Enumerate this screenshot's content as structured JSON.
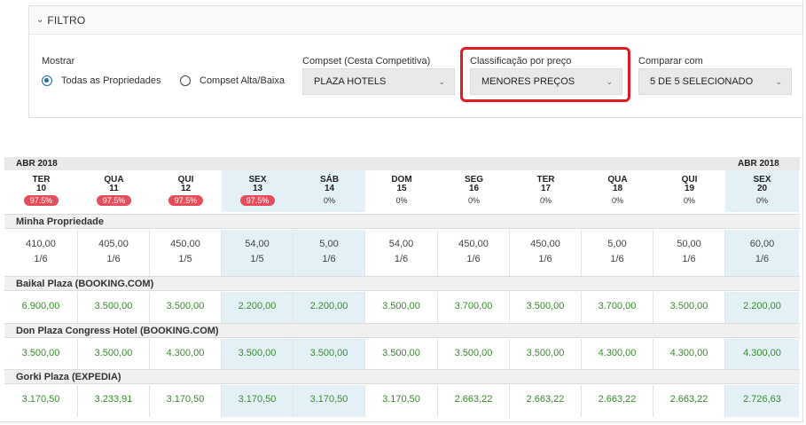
{
  "filter": {
    "title": "FILTRO",
    "show_label": "Mostrar",
    "radio_all": "Todas as Propriedades",
    "radio_compset": "Compset Alta/Baixa",
    "compset_label": "Compset (Cesta Competitiva)",
    "compset_value": "PLAZA HOTELS",
    "sort_label": "Classificação por preço",
    "sort_value": "MENORES PREÇOS",
    "compare_label": "Comparar com",
    "compare_value": "5 DE 5 SELECIONADO"
  },
  "grid": {
    "month_left": "ABR 2018",
    "month_right": "ABR 2018",
    "days": [
      {
        "name": "TER",
        "num": "10",
        "pct": "97.5%",
        "bad": true,
        "hl": false
      },
      {
        "name": "QUA",
        "num": "11",
        "pct": "97.5%",
        "bad": true,
        "hl": false
      },
      {
        "name": "QUI",
        "num": "12",
        "pct": "97.5%",
        "bad": true,
        "hl": false
      },
      {
        "name": "SEX",
        "num": "13",
        "pct": "97.5%",
        "bad": true,
        "hl": true
      },
      {
        "name": "SÁB",
        "num": "14",
        "pct": "0%",
        "bad": false,
        "hl": true
      },
      {
        "name": "DOM",
        "num": "15",
        "pct": "0%",
        "bad": false,
        "hl": false
      },
      {
        "name": "SEG",
        "num": "16",
        "pct": "0%",
        "bad": false,
        "hl": false
      },
      {
        "name": "TER",
        "num": "17",
        "pct": "0%",
        "bad": false,
        "hl": false
      },
      {
        "name": "QUA",
        "num": "18",
        "pct": "0%",
        "bad": false,
        "hl": false
      },
      {
        "name": "QUI",
        "num": "19",
        "pct": "0%",
        "bad": false,
        "hl": false
      },
      {
        "name": "SEX",
        "num": "20",
        "pct": "0%",
        "bad": false,
        "hl": true
      }
    ],
    "sections": [
      {
        "name": "Minha Propriedade",
        "green": false,
        "values": [
          "410,00",
          "405,00",
          "450,00",
          "54,00",
          "5,00",
          "54,00",
          "450,00",
          "450,00",
          "5,00",
          "50,00",
          "60,00"
        ],
        "subs": [
          "1/6",
          "1/6",
          "1/5",
          "1/5",
          "1/6",
          "1/6",
          "1/6",
          "1/6",
          "1/6",
          "1/6",
          "1/6"
        ]
      },
      {
        "name": "Baikal Plaza (BOOKING.COM)",
        "green": true,
        "values": [
          "6.900,00",
          "3.500,00",
          "3.500,00",
          "2.200,00",
          "2.200,00",
          "3.500,00",
          "3.700,00",
          "3.500,00",
          "3.700,00",
          "3.500,00",
          "2.200,00"
        ]
      },
      {
        "name": "Don Plaza Congress Hotel (BOOKING.COM)",
        "green": true,
        "values": [
          "3.500,00",
          "3.500,00",
          "4.300,00",
          "3.500,00",
          "3.500,00",
          "3.500,00",
          "3.500,00",
          "3.500,00",
          "4.300,00",
          "4.300,00",
          "4.300,00"
        ]
      },
      {
        "name": "Gorki Plaza (EXPEDIA)",
        "green": true,
        "values": [
          "3.170,50",
          "3.233,91",
          "3.170,50",
          "3.170,50",
          "3.170,50",
          "3.170,50",
          "2.663,22",
          "2.663,22",
          "2.663,22",
          "2.663,22",
          "2.726,63"
        ]
      }
    ]
  }
}
